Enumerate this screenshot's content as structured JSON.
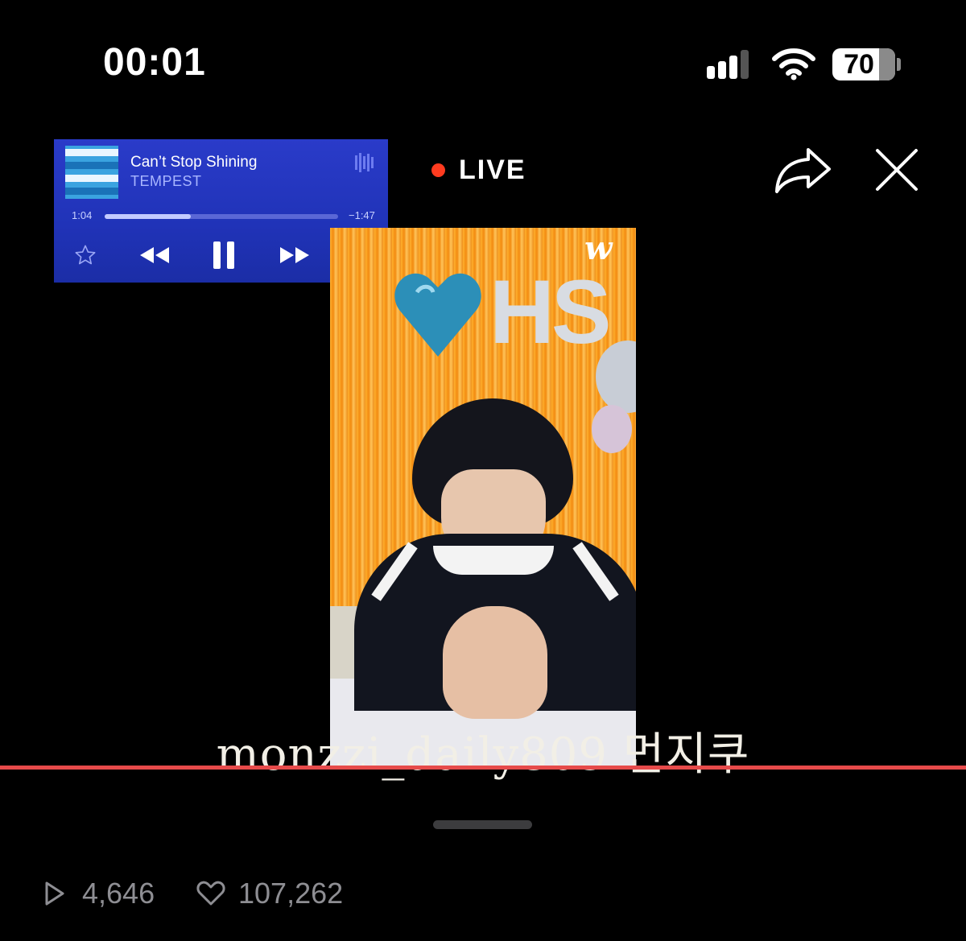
{
  "status_bar": {
    "time": "00:01",
    "battery": "70",
    "icons": [
      "cellular-signal-icon",
      "wifi-icon",
      "battery-icon"
    ]
  },
  "now_playing": {
    "title": "Can’t Stop Shining",
    "artist": "TEMPEST",
    "elapsed": "1:04",
    "remaining": "−1:47",
    "progress": 0.37,
    "icons": [
      "album-art",
      "waveform-icon",
      "star-icon",
      "rewind-icon",
      "pause-icon",
      "fast-forward-icon",
      "airplay-icon"
    ],
    "colors": {
      "background": "#2336bb",
      "accent": "#c3cbff"
    }
  },
  "live": {
    "label": "LIVE",
    "dot_color": "#ff3b1f",
    "icons": [
      "share-icon",
      "close-icon"
    ]
  },
  "video": {
    "logo_text": "w",
    "balloon_text": "HS"
  },
  "watermark": "monzzi_daily809 먼지쿠",
  "stats": {
    "plays": "4,646",
    "likes": "107,262",
    "icons": [
      "play-icon",
      "heart-icon"
    ]
  }
}
